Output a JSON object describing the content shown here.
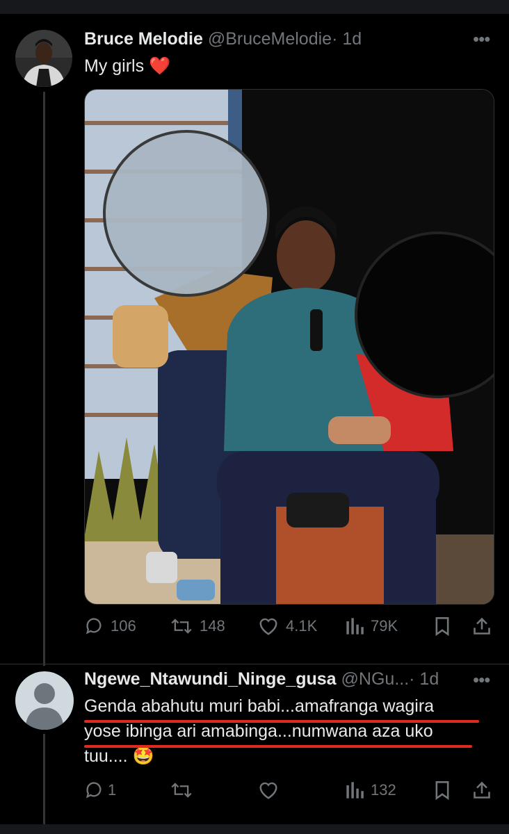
{
  "post": {
    "author_name": "Bruce Melodie",
    "author_handle": "@BruceMelodie",
    "time": "· 1d",
    "text": "My girls",
    "emoji": "❤️",
    "more_icon": "more-icon",
    "stats": {
      "replies": "106",
      "reposts": "148",
      "likes": "4.1K",
      "views": "79K"
    }
  },
  "reply": {
    "author_name": "Ngewe_Ntawundi_Ninge_gusa",
    "author_handle": "@NGu...",
    "time": "· 1d",
    "line1": "Genda abahutu muri babi...amafranga wagira",
    "line2": "yose ibinga ari amabinga...numwana aza uko",
    "line3": "tuu....",
    "emoji": "🤩",
    "stats": {
      "replies": "1",
      "views": "132"
    }
  },
  "colors": {
    "background": "#000000",
    "text": "#e7e9ea",
    "muted": "#71767b",
    "underline": "#e0291f"
  }
}
